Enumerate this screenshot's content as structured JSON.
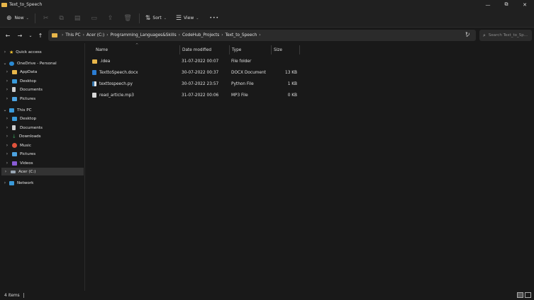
{
  "window": {
    "title": "Text_to_Speech",
    "minimize_glyph": "—",
    "maximize_glyph": "⧉",
    "close_glyph": "✕"
  },
  "commandbar": {
    "new_label": "New",
    "sort_label": "Sort",
    "view_label": "View",
    "more_glyph": "•••"
  },
  "address": {
    "crumbs": [
      "This PC",
      "Acer (C:)",
      "Programming_Languages&Skills",
      "CodeHub_Projects",
      "Text_to_Speech"
    ],
    "search_placeholder": "Search Text_to_Sp..."
  },
  "sidebar": {
    "quick_access": "Quick access",
    "onedrive": "OneDrive - Personal",
    "onedrive_items": [
      "AppData",
      "Desktop",
      "Documents",
      "Pictures"
    ],
    "this_pc": "This PC",
    "this_pc_items": [
      "Desktop",
      "Documents",
      "Downloads",
      "Music",
      "Pictures",
      "Videos",
      "Acer (C:)"
    ],
    "network": "Network"
  },
  "columns": {
    "name": "Name",
    "date": "Date modified",
    "type": "Type",
    "size": "Size"
  },
  "files": [
    {
      "name": ".idea",
      "date": "31-07-2022 00:07",
      "type": "File folder",
      "size": ""
    },
    {
      "name": "TexttoSpeech.docx",
      "date": "30-07-2022 00:37",
      "type": "DOCX Document",
      "size": "13 KB"
    },
    {
      "name": "texttospeech.py",
      "date": "30-07-2022 23:57",
      "type": "Python File",
      "size": "1 KB"
    },
    {
      "name": "read_article.mp3",
      "date": "31-07-2022 00:06",
      "type": "MP3 File",
      "size": "0 KB"
    }
  ],
  "status": {
    "count": "4 items"
  },
  "colors": {
    "folder": "#e8b64a",
    "word": "#2b7cd3",
    "python": "#3776ab",
    "bg": "#191919"
  }
}
